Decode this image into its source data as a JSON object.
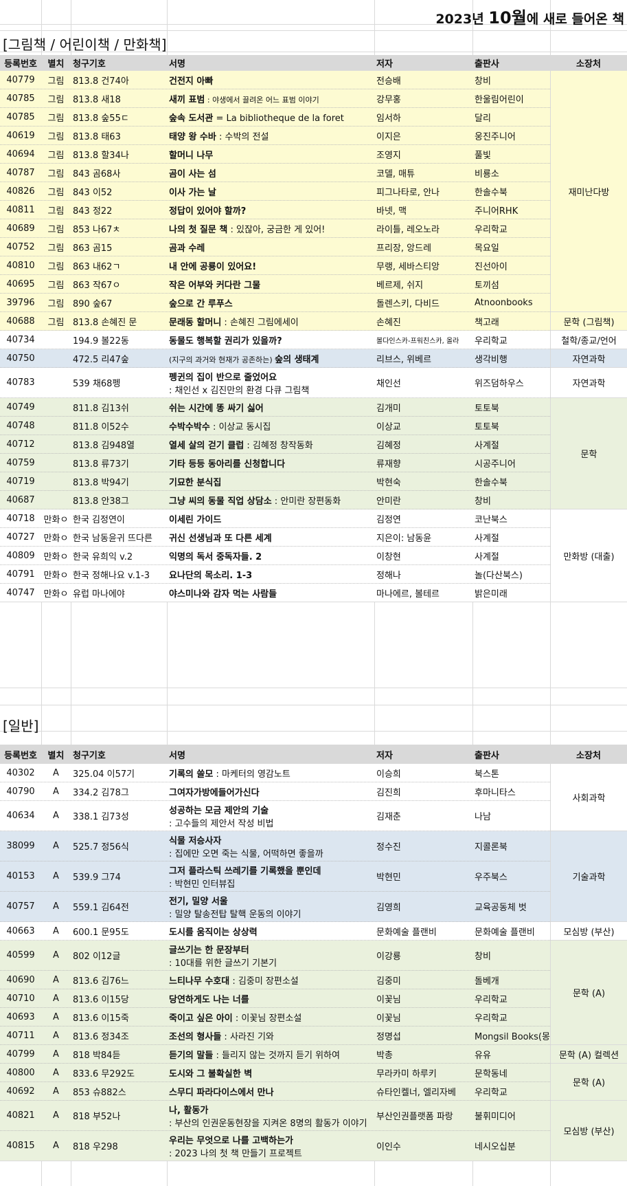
{
  "header": {
    "year_label": "2023년 ",
    "month_label": "10월",
    "rest_label": "에 새로 들어온 책"
  },
  "sections": {
    "picture": "[그림책 / 어린이책 / 만화책]",
    "general": "[일반]"
  },
  "columns": [
    "등록번호",
    "별치",
    "청구기호",
    "서명",
    "저자",
    "출판사",
    "소장처"
  ],
  "picture_rows": [
    {
      "no": "40779",
      "sub": "그림",
      "call": "813.8 건74아",
      "title": "건전지 아빠",
      "subtitle": "",
      "author": "전승배",
      "pub": "창비"
    },
    {
      "no": "40785",
      "sub": "그림",
      "call": "813.8 새18",
      "title": "새끼 표범",
      "subtitle": " : 야생에서 끌려온 어느 표범 이야기",
      "author": "강무홍",
      "pub": "한울림어린이"
    },
    {
      "no": "40785",
      "sub": "그림",
      "call": "813.8 숲55ㄷ",
      "title": "숲속 도서관",
      "subtitle": " = La bibliotheque de la foret",
      "author": "임서하",
      "pub": "달리"
    },
    {
      "no": "40619",
      "sub": "그림",
      "call": "813.8 태63",
      "title": "태양 왕 수바",
      "subtitle": " : 수박의 전설",
      "author": "이지은",
      "pub": "웅진주니어"
    },
    {
      "no": "40694",
      "sub": "그림",
      "call": "813.8 할34나",
      "title": "할머니 나무",
      "subtitle": "",
      "author": "조영지",
      "pub": "풀빛"
    },
    {
      "no": "40787",
      "sub": "그림",
      "call": "843 곰68사",
      "title": "곰이 사는 섬",
      "subtitle": "",
      "author": "코델, 매튜",
      "pub": "비룡소"
    },
    {
      "no": "40826",
      "sub": "그림",
      "call": "843 이52",
      "title": "이사 가는 날",
      "subtitle": "",
      "author": "피그나타로, 안나",
      "pub": "한솔수북"
    },
    {
      "no": "40811",
      "sub": "그림",
      "call": "843 정22",
      "title": "정답이 있어야 할까?",
      "subtitle": "",
      "author": "바넷, 맥",
      "pub": "주니어RHK"
    },
    {
      "no": "40689",
      "sub": "그림",
      "call": "853 나67ㅊ",
      "title": "나의 첫 질문 책",
      "subtitle": " : 있잖아, 궁금한 게 있어!",
      "author": "라이틀, 레오노라",
      "pub": "우리학교"
    },
    {
      "no": "40752",
      "sub": "그림",
      "call": "863 곰15",
      "title": "곰과 수레",
      "subtitle": "",
      "author": "프리장, 앙드레",
      "pub": "목요일"
    },
    {
      "no": "40810",
      "sub": "그림",
      "call": "863 내62ㄱ",
      "title": "내 안에 공룡이 있어요!",
      "subtitle": "",
      "author": "무랭, 세바스티앙",
      "pub": "진선아이"
    },
    {
      "no": "40695",
      "sub": "그림",
      "call": "863 작67ㅇ",
      "title": "작은 어부와 커다란 그물",
      "subtitle": "",
      "author": "베르제, 쉬지",
      "pub": "토끼섬"
    },
    {
      "no": "39796",
      "sub": "그림",
      "call": "890 숲67",
      "title": "숲으로 간 루푸스",
      "subtitle": "",
      "author": "돌렌스키, 다비드",
      "pub": "Atnoonbooks"
    },
    {
      "no": "40688",
      "sub": "그림",
      "call": "813.8 손혜진 문",
      "title": "문래동 할머니",
      "subtitle": " : 손혜진 그림에세이",
      "author": "손혜진",
      "pub": "책고래"
    },
    {
      "no": "40734",
      "sub": "",
      "call": "194.9 볼22동",
      "title": "동물도 행복할 권리가 있을까?",
      "subtitle": "",
      "author": "볼다인스카-프워친스카, 올라",
      "pub": "우리학교"
    },
    {
      "no": "40750",
      "sub": "",
      "call": "472.5 리47숲",
      "title": "숲의 생태계",
      "prefix": "(지구의 과거와 현재가 공존하는) ",
      "subtitle": "",
      "author": "리브스, 위베르",
      "pub": "생각비행"
    },
    {
      "no": "40783",
      "sub": "",
      "call": "539 채68펭",
      "title": "펭귄의 집이 반으로 줄었어요",
      "subtitle": " : 채인선 x 김진만의 환경 다큐 그림책",
      "author": "채인선",
      "pub": "위즈덤하우스"
    },
    {
      "no": "40749",
      "sub": "",
      "call": "811.8 김13쉬",
      "title": "쉬는 시간에 똥 싸기 싫어",
      "subtitle": "",
      "author": "김개미",
      "pub": "토토북"
    },
    {
      "no": "40748",
      "sub": "",
      "call": "811.8 이52수",
      "title": "수박수박수",
      "subtitle": " : 이상교 동시집",
      "author": "이상교",
      "pub": "토토북"
    },
    {
      "no": "40712",
      "sub": "",
      "call": "813.8 김948열",
      "title": "열세 살의 걷기 클럽",
      "subtitle": " : 김혜정 창작동화",
      "author": "김혜정",
      "pub": "사계절"
    },
    {
      "no": "40759",
      "sub": "",
      "call": "813.8 류73기",
      "title": "기타 등등 동아리를 신청합니다",
      "subtitle": "",
      "author": "류재향",
      "pub": "시공주니어"
    },
    {
      "no": "40719",
      "sub": "",
      "call": "813.8 박94기",
      "title": "기묘한 분식집",
      "subtitle": "",
      "author": "박현숙",
      "pub": "한솔수북"
    },
    {
      "no": "40687",
      "sub": "",
      "call": "813.8 안38그",
      "title": "그냥 씨의 동물 직업 상담소",
      "subtitle": " : 안미란 장편동화",
      "author": "안미란",
      "pub": "창비"
    },
    {
      "no": "40718",
      "sub": "만화ㅇ",
      "call": "한국 김정연이",
      "title": "이세린 가이드",
      "subtitle": "",
      "author": "김정연",
      "pub": "코난북스"
    },
    {
      "no": "40727",
      "sub": "만화ㅇ",
      "call": "한국 남동윤귀 뜨다른",
      "title": "귀신 선생님과 또 다른 세계",
      "subtitle": "",
      "author": "지은이: 남동윤",
      "pub": "사계절"
    },
    {
      "no": "40809",
      "sub": "만화ㅇ",
      "call": "한국 유희익 v.2",
      "title": "익명의 독서 중독자들. 2",
      "subtitle": "",
      "author": "이창현",
      "pub": "사계절"
    },
    {
      "no": "40791",
      "sub": "만화ㅇ",
      "call": "한국 정해나요 v.1-3",
      "title": "요나단의 목소리. 1-3",
      "subtitle": "",
      "author": "정해나",
      "pub": "놀(다산북스)"
    },
    {
      "no": "40747",
      "sub": "만화ㅇ",
      "call": "유럽 마나에야",
      "title": "야스미나와 감자 먹는 사람들",
      "subtitle": "",
      "author": "마나에르, 볼테르",
      "pub": "밝은미래"
    }
  ],
  "picture_locations": [
    "재미난다방",
    "문학 (그림책)",
    "철학/종교/언어",
    "자연과학",
    "자연과학",
    "문학",
    "만화방 (대출)"
  ],
  "general_rows": [
    {
      "no": "40302",
      "sub": "A",
      "call": "325.04 이57기",
      "title": "기록의 쓸모",
      "subtitle": " : 마케터의 영감노트",
      "author": "이승희",
      "pub": "북스톤"
    },
    {
      "no": "40790",
      "sub": "A",
      "call": "334.2 김78그",
      "title": "그여자가방에들어가신다",
      "subtitle": "",
      "author": "김진희",
      "pub": "후마니타스"
    },
    {
      "no": "40634",
      "sub": "A",
      "call": "338.1 김73성",
      "title": "성공하는 모금 제안의 기술",
      "subtitle": " : 고수들의 제안서 작성 비법",
      "author": "김재춘",
      "pub": "나남"
    },
    {
      "no": "38099",
      "sub": "A",
      "call": "525.7 정56식",
      "title": "식물 저승사자",
      "subtitle": " : 집에만 오면 죽는 식물, 어떡하면 좋을까",
      "author": "정수진",
      "pub": "지콜론북"
    },
    {
      "no": "40153",
      "sub": "A",
      "call": "539.9 그74",
      "title": "그저 플라스틱 쓰레기를 기록했을 뿐인데",
      "subtitle": " : 박현민 인터뷰집",
      "author": "박현민",
      "pub": "우주북스"
    },
    {
      "no": "40757",
      "sub": "A",
      "call": "559.1 김64전",
      "title": "전기, 밀양 서울",
      "subtitle": " : 밀양 탈송전탑 탈핵 운동의 이야기",
      "author": "김영희",
      "pub": "교육공동체 벗"
    },
    {
      "no": "40663",
      "sub": "A",
      "call": "600.1 문95도",
      "title": "도시를 움직이는 상상력",
      "subtitle": "",
      "author": "문화예술 플랜비",
      "pub": "문화예술 플랜비"
    },
    {
      "no": "40599",
      "sub": "A",
      "call": "802 이12글",
      "title": "글쓰기는 한 문장부터",
      "subtitle": " : 10대를 위한 글쓰기 기본기",
      "author": "이강룡",
      "pub": "창비"
    },
    {
      "no": "40690",
      "sub": "A",
      "call": "813.6 김76느",
      "title": "느티나무 수호대",
      "subtitle": " : 김중미 장편소설",
      "author": "김중미",
      "pub": "돌베개"
    },
    {
      "no": "40710",
      "sub": "A",
      "call": "813.6 이15당",
      "title": "당연하게도 나는 너를",
      "subtitle": "",
      "author": "이꽃님",
      "pub": "우리학교"
    },
    {
      "no": "40693",
      "sub": "A",
      "call": "813.6 이15죽",
      "title": "죽이고 싶은 아이",
      "subtitle": " : 이꽃님 장편소설",
      "author": "이꽃님",
      "pub": "우리학교"
    },
    {
      "no": "40711",
      "sub": "A",
      "call": "813.6 정34조",
      "title": "조선의 형사들",
      "subtitle": " : 사라진 기와",
      "author": "정명섭",
      "pub": "Mongsil Books(몽"
    },
    {
      "no": "40799",
      "sub": "A",
      "call": "818 박84듣",
      "title": "듣기의 말들",
      "subtitle": " : 들리지 않는 것까지 듣기 위하여",
      "author": "박총",
      "pub": "유유"
    },
    {
      "no": "40800",
      "sub": "A",
      "call": "833.6 무292도",
      "title": "도시와 그 불확실한 벽",
      "subtitle": "",
      "author": "무라카미 하루키",
      "pub": "문학동네"
    },
    {
      "no": "40692",
      "sub": "A",
      "call": "853 슈882스",
      "title": "스무디 파라다이스에서 만나",
      "subtitle": "",
      "author": "슈타인켈너, 엘리자베",
      "pub": "우리학교"
    },
    {
      "no": "40821",
      "sub": "A",
      "call": "818 부52나",
      "title": "나, 활동가",
      "subtitle": " : 부산의 인권운동현장을 지켜온 8명의 활동가 이야기",
      "author": "부산인권플랫폼 파랑",
      "pub": "불휘미디어"
    },
    {
      "no": "40815",
      "sub": "A",
      "call": "818 우298",
      "title": "우리는 무엇으로 나를 고백하는가",
      "subtitle": " : 2023 나의 첫 책 만들기 프로젝트",
      "author": "이인수",
      "pub": "네시오십분"
    }
  ],
  "general_locations": [
    "사회과학",
    "기술과학",
    "모심방 (부산)",
    "문학 (A)",
    "문학 (A) 컬렉션",
    "문학 (A)",
    "모심방 (부산)"
  ],
  "colors": {
    "yellow": "#fdfbd2",
    "blue": "#dce6f0",
    "green": "#eaf1dd",
    "header": "#d9d9d9"
  }
}
